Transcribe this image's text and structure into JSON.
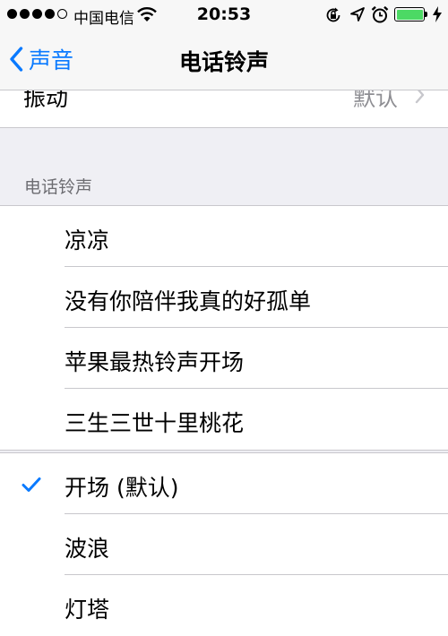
{
  "status_bar": {
    "carrier": "中国电信",
    "time": "20:53",
    "battery_color": "#4cd964"
  },
  "nav": {
    "back_label": "声音",
    "title": "电话铃声"
  },
  "vibration": {
    "label": "振动",
    "value": "默认"
  },
  "section_header": "电话铃声",
  "custom_ringtones": [
    {
      "label": "凉凉"
    },
    {
      "label": "没有你陪伴我真的好孤单"
    },
    {
      "label": "苹果最热铃声开场"
    },
    {
      "label": "三生三世十里桃花"
    }
  ],
  "system_ringtones": [
    {
      "label": "开场 (默认)",
      "selected": true
    },
    {
      "label": "波浪",
      "selected": false
    },
    {
      "label": "灯塔",
      "selected": false
    }
  ],
  "colors": {
    "accent": "#0a7aff",
    "separator": "#c8c7cc",
    "secondary_text": "#8e8e93"
  }
}
